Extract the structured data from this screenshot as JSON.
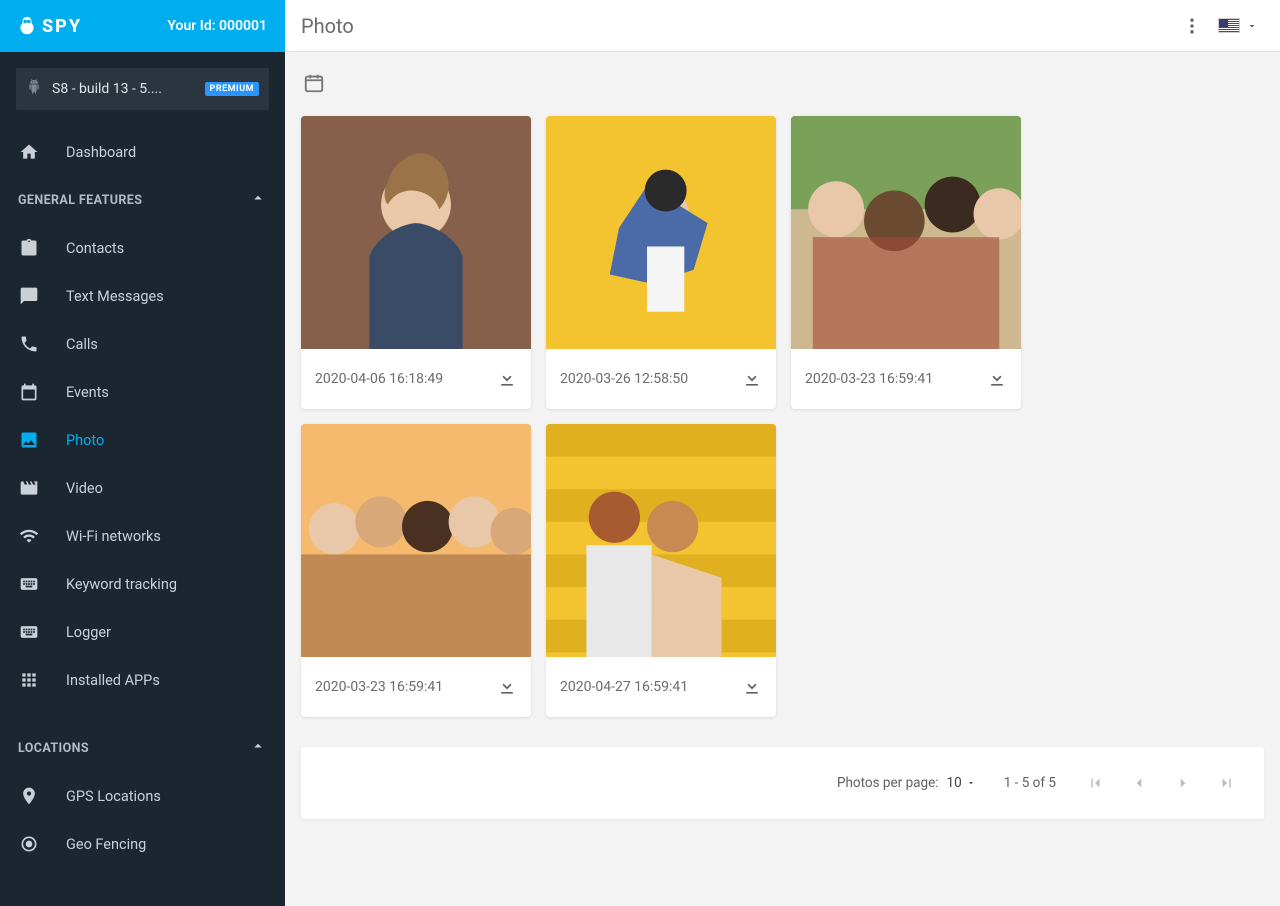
{
  "brand": "SPY",
  "user_id_label": "Your Id: 000001",
  "device": {
    "label": "S8 - build 13 - 5....",
    "badge": "PREMIUM"
  },
  "page_title": "Photo",
  "nav": {
    "dashboard": "Dashboard",
    "section_general": "GENERAL FEATURES",
    "contacts": "Contacts",
    "text_messages": "Text Messages",
    "calls": "Calls",
    "events": "Events",
    "photo": "Photo",
    "video": "Video",
    "wifi": "Wi-Fi networks",
    "keyword": "Keyword tracking",
    "logger": "Logger",
    "installed_apps": "Installed APPs",
    "section_locations": "LOCATIONS",
    "gps": "GPS Locations",
    "geofencing": "Geo Fencing"
  },
  "photos": [
    {
      "timestamp": "2020-04-06 16:18:49"
    },
    {
      "timestamp": "2020-03-26 12:58:50"
    },
    {
      "timestamp": "2020-03-23 16:59:41"
    },
    {
      "timestamp": "2020-03-23 16:59:41"
    },
    {
      "timestamp": "2020-04-27 16:59:41"
    }
  ],
  "pager": {
    "label": "Photos per page:",
    "per_page": "10",
    "range": "1 - 5 of 5"
  }
}
